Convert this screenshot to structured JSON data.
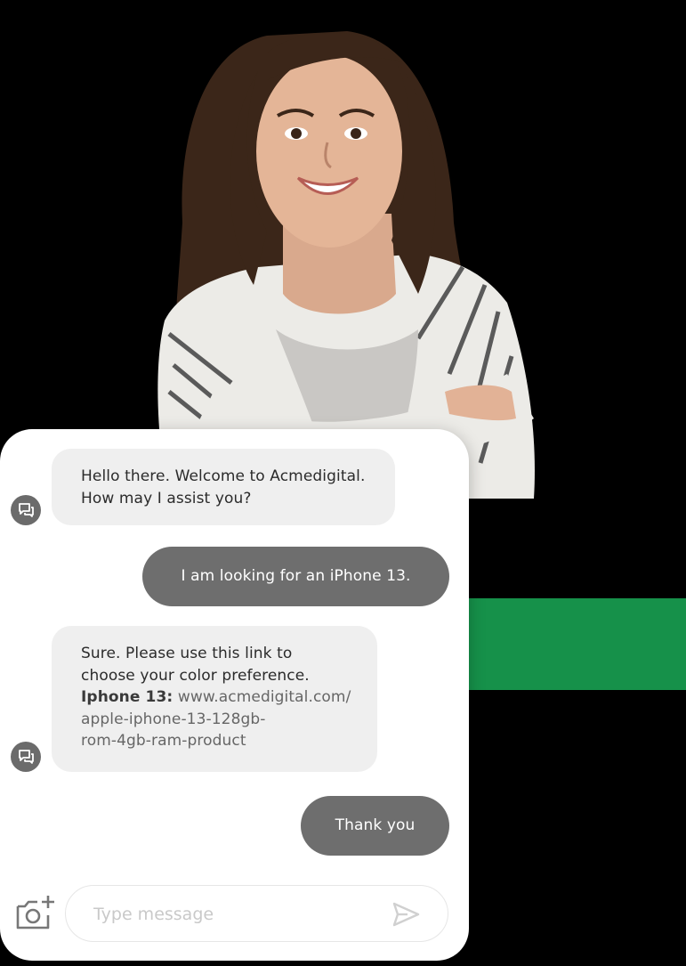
{
  "colors": {
    "background": "#000000",
    "accent_green": "#16914a",
    "bot_bubble": "#efefef",
    "user_bubble": "#6e6e6e",
    "avatar": "#6b6b6b"
  },
  "chat": {
    "messages": [
      {
        "sender": "bot",
        "lines": [
          "Hello there. Welcome to Acmedigital.",
          "How may I assist you?"
        ]
      },
      {
        "sender": "user",
        "text": "I am looking for an iPhone 13."
      },
      {
        "sender": "bot",
        "lines": [
          "Sure. Please use this link to",
          "choose your color preference."
        ],
        "link_label": "Iphone 13:",
        "link_lines": [
          "www.acmedigital.com/",
          "apple-iphone-13-128gb-",
          "rom-4gb-ram-product"
        ]
      },
      {
        "sender": "user",
        "text": "Thank you"
      }
    ],
    "composer": {
      "placeholder": "Type message"
    }
  },
  "icons": {
    "bot_avatar": "chat-bubbles-icon",
    "camera": "add-photo-icon",
    "send": "send-icon"
  }
}
